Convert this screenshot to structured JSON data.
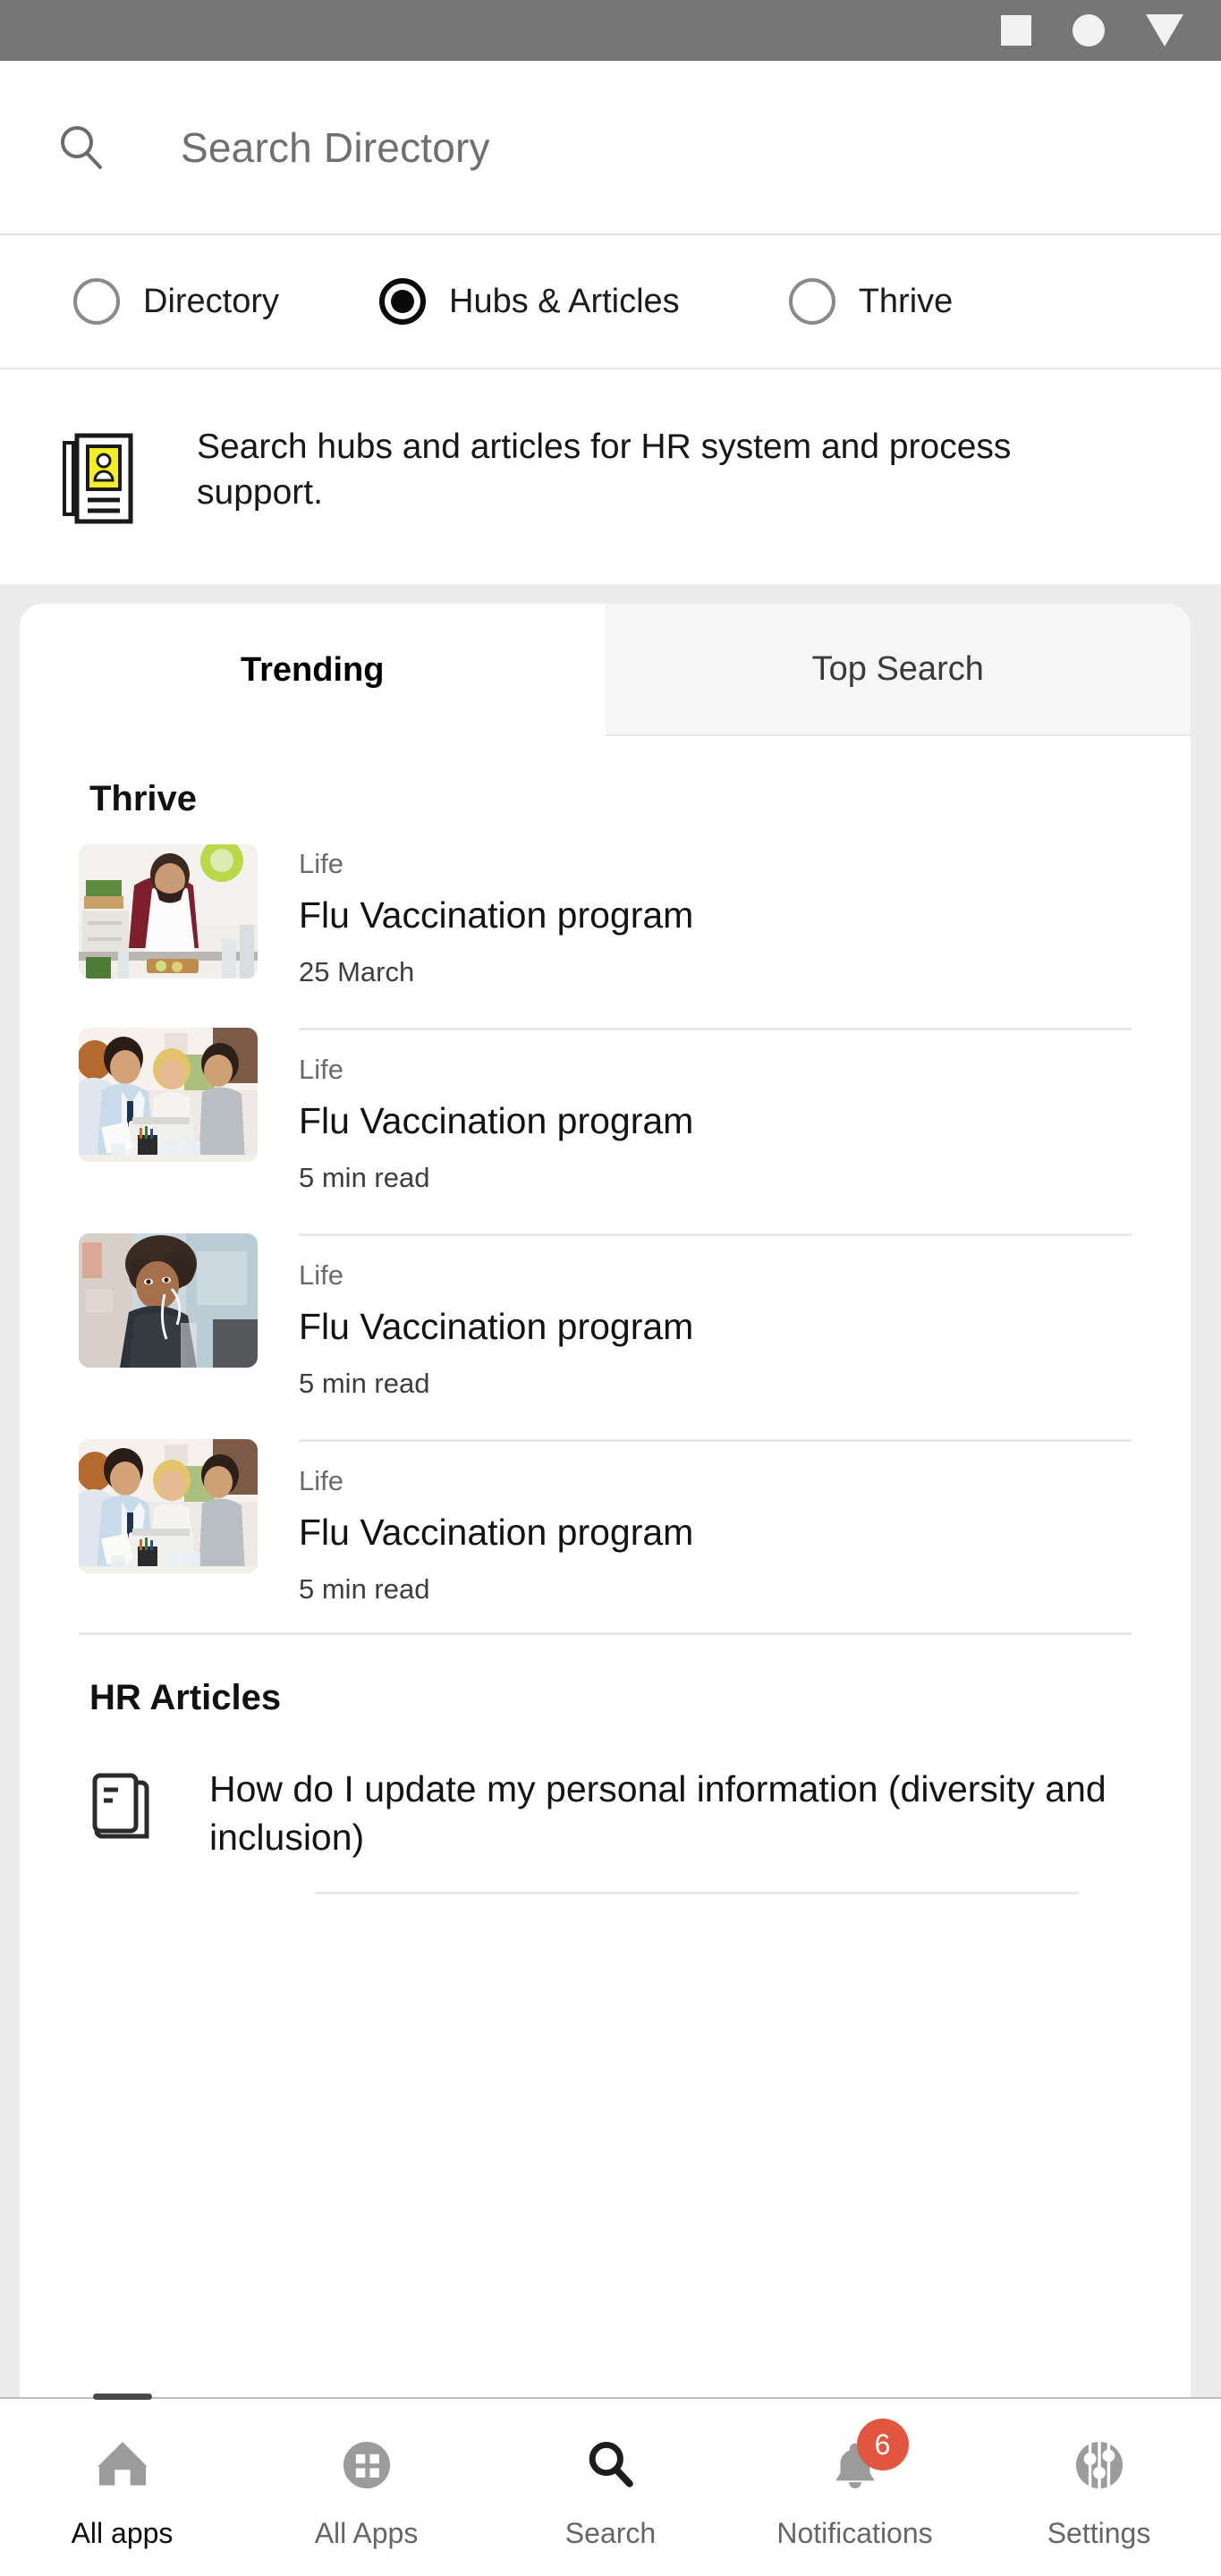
{
  "status_bar": {
    "background": "#767676",
    "icons": [
      "square-icon",
      "circle-icon",
      "triangle-down-icon"
    ]
  },
  "search": {
    "icon": "search-icon",
    "placeholder": "Search Directory",
    "value": ""
  },
  "filters": {
    "options": [
      {
        "label": "Directory",
        "selected": false
      },
      {
        "label": "Hubs & Articles",
        "selected": true
      },
      {
        "label": "Thrive",
        "selected": false
      }
    ]
  },
  "info_banner": {
    "icon": "articles-stack-icon",
    "icon_accent_color": "#f5ee26",
    "text": "Search hubs and articles for HR system and process support."
  },
  "tabs": [
    {
      "label": "Trending",
      "active": true
    },
    {
      "label": "Top Search",
      "active": false
    }
  ],
  "thrive": {
    "section_title": "Thrive",
    "articles": [
      {
        "image": "man-cooking-kitchen-photo",
        "kicker": "Life",
        "title": "Flu Vaccination program",
        "sub": "25 March"
      },
      {
        "image": "business-meeting-laptop-photo",
        "kicker": "Life",
        "title": "Flu Vaccination program",
        "sub": "5 min read"
      },
      {
        "image": "woman-headphones-street-photo",
        "kicker": "Life",
        "title": "Flu Vaccination program",
        "sub": "5 min read"
      },
      {
        "image": "business-meeting-laptop-photo",
        "kicker": "Life",
        "title": "Flu Vaccination program",
        "sub": "5 min read"
      }
    ]
  },
  "hr_articles": {
    "section_title": "HR Articles",
    "items": [
      {
        "icon": "document-article-icon",
        "title": "How do I update my personal information (diversity and inclusion)"
      }
    ]
  },
  "bottom_nav": {
    "items": [
      {
        "label": "All apps",
        "icon": "home-icon",
        "active": true,
        "badge": ""
      },
      {
        "label": "All Apps",
        "icon": "grid-apps-icon",
        "active": false,
        "badge": ""
      },
      {
        "label": "Search",
        "icon": "search-icon",
        "active": false,
        "badge": ""
      },
      {
        "label": "Notifications",
        "icon": "bell-icon",
        "active": false,
        "badge": "6"
      },
      {
        "label": "Settings",
        "icon": "settings-sliders-icon",
        "active": false,
        "badge": ""
      }
    ],
    "badge_color": "#e2563f"
  }
}
